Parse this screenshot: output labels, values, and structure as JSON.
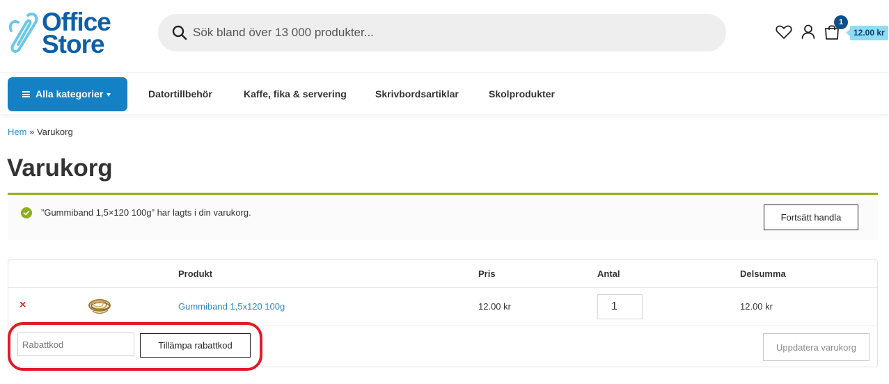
{
  "header": {
    "logo_line1": "Office",
    "logo_line2": "Store",
    "search_placeholder": "Sök bland över 13 000 produkter...",
    "icons": [
      "search-icon",
      "heart-icon",
      "user-icon",
      "shopping-bag-icon"
    ],
    "cart_count": "1",
    "cart_total": "12.00 kr"
  },
  "nav": {
    "categories_label": "Alla kategorier",
    "links": [
      "Datortillbehör",
      "Kaffe, fika & servering",
      "Skrivbordsartiklar",
      "Skolprodukter"
    ]
  },
  "breadcrumb": {
    "home": "Hem",
    "separator": "»",
    "current": "Varukorg"
  },
  "page_title": "Varukorg",
  "notice": {
    "message": "”Gummiband 1,5×120 100g” har lagts i din varukorg.",
    "continue_label": "Fortsätt handla"
  },
  "cart": {
    "columns": [
      "Produkt",
      "Pris",
      "Antal",
      "Delsumma"
    ],
    "items": [
      {
        "remove": "×",
        "name": "Gummiband 1,5x120 100g",
        "price": "12.00 kr",
        "quantity": "1",
        "subtotal": "12.00 kr"
      }
    ],
    "coupon_placeholder": "Rabattkod",
    "apply_coupon_label": "Tillämpa rabattkod",
    "update_cart_label": "Uppdatera varukorg"
  },
  "colors": {
    "brand_blue": "#1381c4",
    "link_blue": "#2f8ac6",
    "success_green": "#8fae1b",
    "highlight_red": "#e21a2a",
    "remove_red": "#e2261c"
  }
}
